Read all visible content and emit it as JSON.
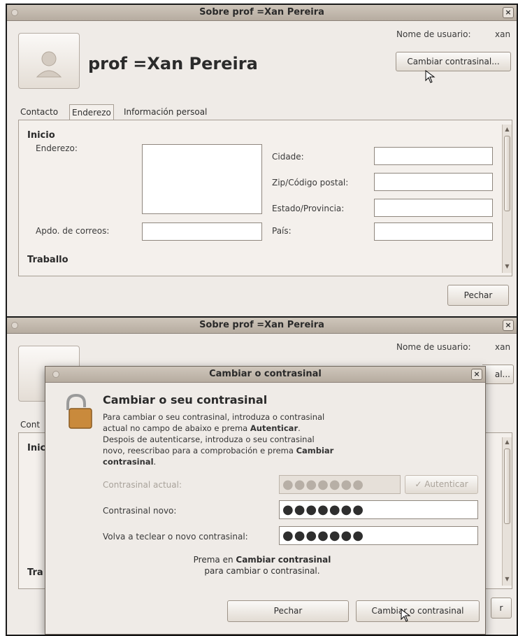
{
  "window1": {
    "title": "Sobre prof =Xan Pereira",
    "display_name": "prof =Xan Pereira",
    "username_label": "Nome de usuario:",
    "username_value": "xan",
    "change_password_button": "Cambiar contrasinal...",
    "tabs": [
      "Contacto",
      "Enderezo",
      "Información persoal"
    ],
    "active_tab": "Enderezo",
    "section_home": "Inicio",
    "section_work": "Traballo",
    "labels": {
      "address": "Enderezo:",
      "po_box": "Apdo. de correos:",
      "city": "Cidade:",
      "zip": "Zip/Código postal:",
      "state": "Estado/Provincia:",
      "country": "País:"
    },
    "close_button": "Pechar"
  },
  "window2": {
    "title": "Sobre prof =Xan Pereira",
    "username_label": "Nome de usuario:",
    "username_value": "xan",
    "partial_button": "al...",
    "partial_tab": "Cont",
    "partial_section_home": "Inic",
    "partial_section_work": "Tra",
    "partial_close": "r"
  },
  "dialog": {
    "title": "Cambiar o contrasinal",
    "heading": "Cambiar o seu contrasinal",
    "desc_line1": "Para cambiar o seu contrasinal, introduza o contrasinal",
    "desc_line2_pre": "actual no campo de abaixo e prema ",
    "desc_line2_bold": "Autenticar",
    "desc_line2_post": ".",
    "desc_line3": "Despois de autenticarse, introduza o seu contrasinal",
    "desc_line4_pre": "novo, reescribao para a comprobación e prema ",
    "desc_line4_bold": "Cambiar",
    "desc_line5_bold": "contrasinal",
    "desc_line5_post": ".",
    "current_label": "Contrasinal actual:",
    "current_value": "●●●●●●●",
    "authenticate_button": "Autenticar",
    "new_label": "Contrasinal novo:",
    "new_value": "●●●●●●●",
    "retype_label": "Volva a teclear o novo contrasinal:",
    "retype_value": "●●●●●●●",
    "hint_pre": "Prema en ",
    "hint_bold": "Cambiar contrasinal",
    "hint_line2": "para cambiar o contrasinal.",
    "close_button": "Pechar",
    "change_button": "Cambiar o contrasinal"
  }
}
